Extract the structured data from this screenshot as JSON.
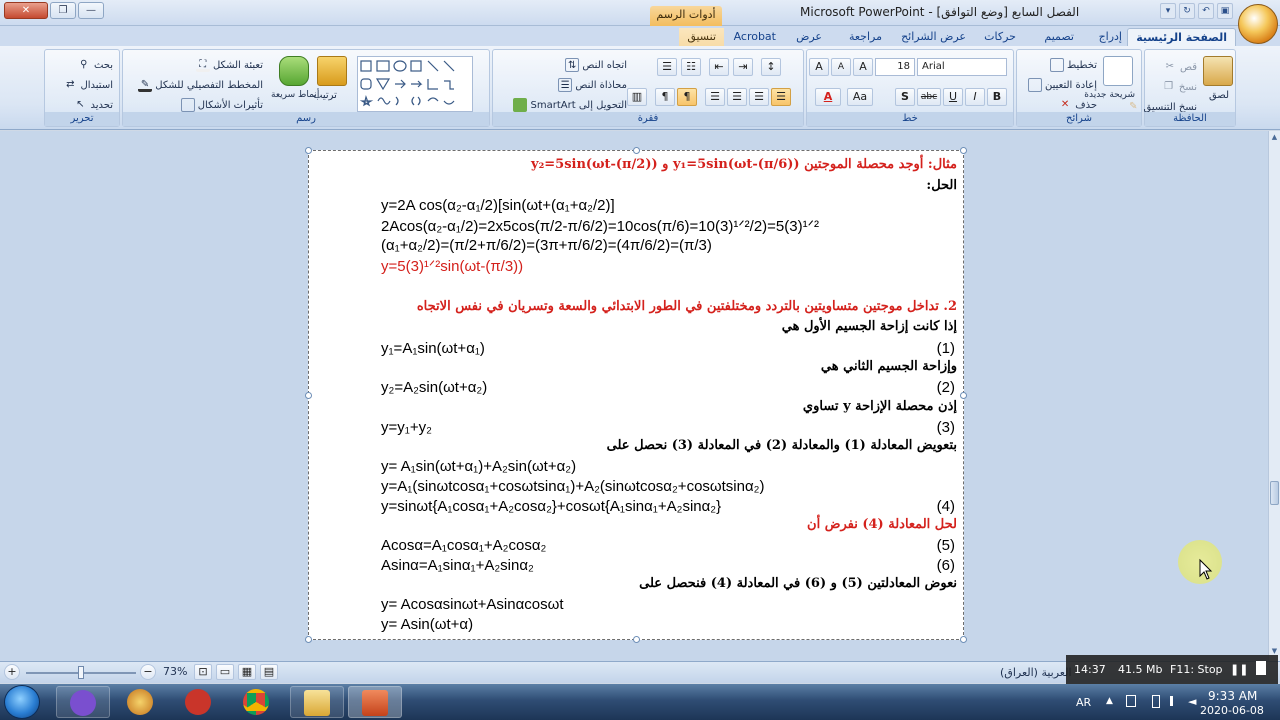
{
  "window": {
    "title": "الفصل السابع [وضع التوافق] - Microsoft PowerPoint",
    "context_tab_group": "أدوات الرسم",
    "controls": {
      "close": "✕",
      "maximize": "❐",
      "minimize": "—"
    }
  },
  "tabs": [
    "الصفحة الرئيسية",
    "إدراج",
    "تصميم",
    "حركات",
    "عرض الشرائح",
    "مراجعة",
    "عرض",
    "Acrobat",
    "تنسيق"
  ],
  "ribbon": {
    "clipboard": {
      "label": "الحافظة",
      "paste": "لصق",
      "cut": "قص",
      "copy": "نسخ",
      "format_painter": "نسخ التنسيق"
    },
    "slides": {
      "label": "شرائح",
      "new_slide": "شريحة جديدة",
      "layout": "تخطيط",
      "reset": "إعادة التعيين",
      "delete": "حذف"
    },
    "font": {
      "label": "خط",
      "font_name": "Arial",
      "font_size": "18",
      "bold": "B",
      "italic": "I",
      "underline": "U",
      "strike": "abc",
      "shadow": "S",
      "change_case": "Aa",
      "grow": "A",
      "shrink": "A",
      "clear": "A"
    },
    "paragraph": {
      "label": "فقرة",
      "text_direction": "اتجاه النص",
      "align_text": "محاذاة النص",
      "smartart": "التحويل إلى SmartArt"
    },
    "drawing": {
      "label": "رسم",
      "arrange": "ترتيب",
      "quick_styles": "أنماط سريعة",
      "shape_fill": "تعبئة الشكل",
      "shape_outline": "المخطط التفصيلي للشكل",
      "shape_effects": "تأثيرات الأشكال"
    },
    "editing": {
      "label": "تحرير",
      "find": "بحث",
      "replace": "استبدال",
      "select": "تحديد"
    }
  },
  "slide": {
    "lines": [
      {
        "kind": "ar",
        "color": "red",
        "text": "مثال: أوجد محصلة الموجتين y₁=5sin(ωt-(π/6)) و y₂=5sin(ωt-(π/2))"
      },
      {
        "kind": "ar",
        "color": "black",
        "text": "الحل:"
      },
      {
        "kind": "eq",
        "color": "black",
        "text": "y=2A cos(α₂-α₁/2)[sin(ωt+(α₁+α₂/2)]"
      },
      {
        "kind": "eq",
        "color": "black",
        "text": "2Acos(α₂-α₁/2)=2x5cos(π/2-π/6/2)=10cos(π/6)=10(3)¹ᐟ²/2)=5(3)¹ᐟ²"
      },
      {
        "kind": "eq",
        "color": "black",
        "text": "(α₁+α₂/2)=(π/2+π/6/2)=(3π+π/6/2)=(4π/6/2)=(π/3)"
      },
      {
        "kind": "eq",
        "color": "red",
        "text": "y=5(3)¹ᐟ²sin(ωt-(π/3))"
      },
      {
        "kind": "ar",
        "color": "red",
        "text": "2. تداخل موجتين متساويتين بالتردد ومختلفتين في الطور الابتدائي والسعة وتسريان في نفس الاتجاه"
      },
      {
        "kind": "ar",
        "color": "black",
        "text": "إذا كانت إزاحة الجسيم الأول هي"
      },
      {
        "kind": "eq",
        "color": "black",
        "text": "y₁=A₁sin(ωt+α₁)",
        "num": "(1)"
      },
      {
        "kind": "ar",
        "color": "black",
        "text": "وإزاحة الجسيم الثاني هي"
      },
      {
        "kind": "eq",
        "color": "black",
        "text": "y₂=A₂sin(ωt+α₂)",
        "num": "(2)"
      },
      {
        "kind": "ar",
        "color": "black",
        "text": "إذن محصلة الإزاحة y تساوي"
      },
      {
        "kind": "eq",
        "color": "black",
        "text": "y=y₁+y₂",
        "num": "(3)"
      },
      {
        "kind": "ar",
        "color": "black",
        "text": "بتعويض المعادلة (1) والمعادلة (2) في المعادلة (3) نحصل على"
      },
      {
        "kind": "eq",
        "color": "black",
        "text": "y= A₁sin(ωt+α₁)+A₂sin(ωt+α₂)"
      },
      {
        "kind": "eq",
        "color": "black",
        "text": "y=A₁(sinωtcosα₁+cosωtsinα₁)+A₂(sinωtcosα₂+cosωtsinα₂)"
      },
      {
        "kind": "eq",
        "color": "black",
        "text": "y=sinωt{A₁cosα₁+A₂cosα₂}+cosωt{A₁sinα₁+A₂sinα₂}",
        "num": "(4)"
      },
      {
        "kind": "ar",
        "color": "red",
        "text": "لحل المعادلة (4) نفرض أن"
      },
      {
        "kind": "eq",
        "color": "black",
        "text": "Acosα=A₁cosα₁+A₂cosα₂",
        "num": "(5)"
      },
      {
        "kind": "eq",
        "color": "black",
        "text": "Asinα=A₁sinα₁+A₂sinα₂",
        "num": "(6)"
      },
      {
        "kind": "ar",
        "color": "black",
        "text": "نعوض المعادلتين (5) و (6) في المعادلة (4) فنحصل على"
      },
      {
        "kind": "eq",
        "color": "black",
        "text": "y= Acosαsinωt+Asinαcosωt"
      },
      {
        "kind": "eq",
        "color": "black",
        "text": "y= Asin(ωt+α)"
      }
    ]
  },
  "statusbar": {
    "zoom": "73%",
    "language": "العربية (العراق)"
  },
  "recorder": {
    "elapsed": "14:37",
    "size": "41.5 Mb",
    "stop": "F11: Stop"
  },
  "taskbar": {
    "lang": "AR",
    "time": "9:33 AM",
    "date": "2020-06-08"
  },
  "colors": {
    "accent_red": "#d4211c",
    "ribbon_blue": "#15428b"
  }
}
